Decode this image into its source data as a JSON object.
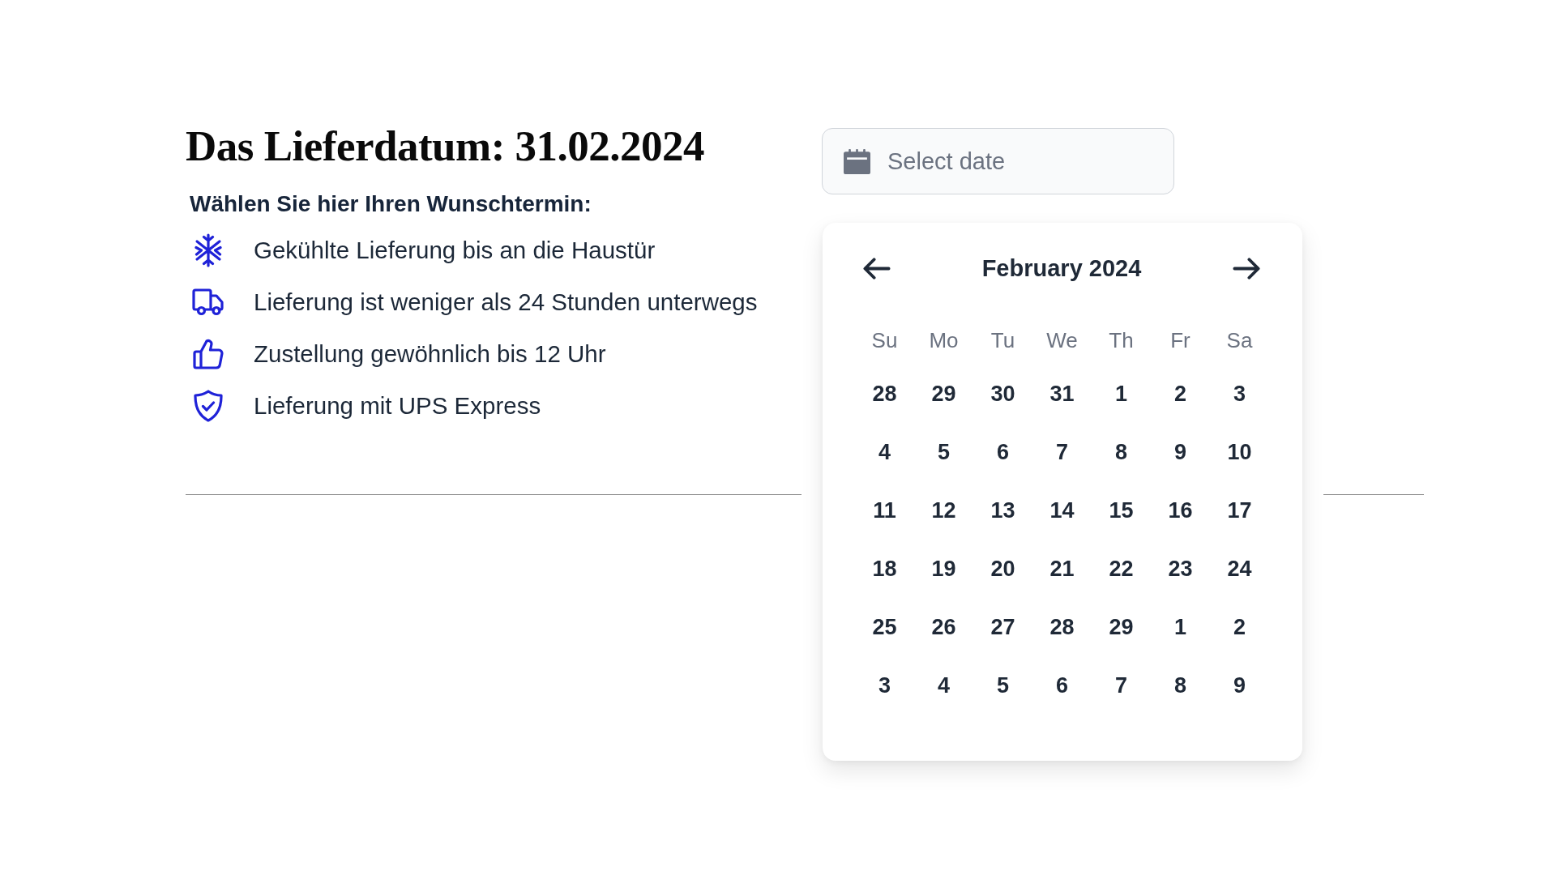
{
  "heading": "Das Lieferdatum: 31.02.2024",
  "subheading": "Wählen Sie hier Ihren Wunschtermin:",
  "features": [
    {
      "kind": "cold",
      "text": "Gekühlte Lieferung bis an die Haustür"
    },
    {
      "kind": "transit",
      "text": "Lieferung ist weniger als 24 Stunden unterwegs"
    },
    {
      "kind": "approval",
      "text": "Zustellung gewöhnlich bis 12 Uhr"
    },
    {
      "kind": "secure",
      "text": "Lieferung mit UPS Express"
    }
  ],
  "date_field": {
    "placeholder": "Select date"
  },
  "calendar": {
    "month_label": "February 2024",
    "weekdays": [
      "Su",
      "Mo",
      "Tu",
      "We",
      "Th",
      "Fr",
      "Sa"
    ],
    "weeks": [
      [
        "28",
        "29",
        "30",
        "31",
        "1",
        "2",
        "3"
      ],
      [
        "4",
        "5",
        "6",
        "7",
        "8",
        "9",
        "10"
      ],
      [
        "11",
        "12",
        "13",
        "14",
        "15",
        "16",
        "17"
      ],
      [
        "18",
        "19",
        "20",
        "21",
        "22",
        "23",
        "24"
      ],
      [
        "25",
        "26",
        "27",
        "28",
        "29",
        "1",
        "2"
      ],
      [
        "3",
        "4",
        "5",
        "6",
        "7",
        "8",
        "9"
      ]
    ]
  }
}
